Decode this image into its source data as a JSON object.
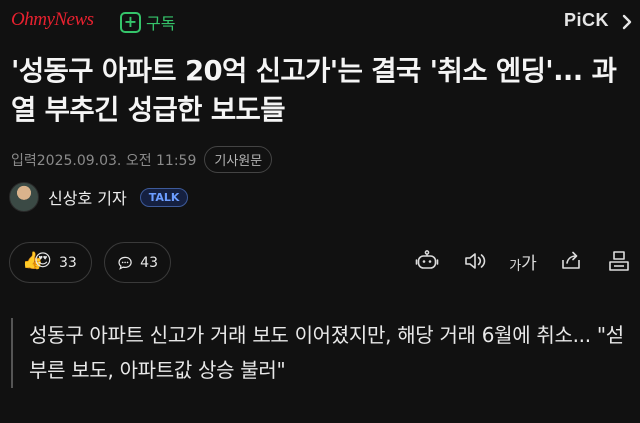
{
  "header": {
    "logo_text": "OhmyNews",
    "subscribe_label": "구독",
    "subscribe_icon": "plus-icon",
    "pick_label": "PiCK",
    "pick_chevron_icon": "chevron-right-icon",
    "colors": {
      "logo": "#e8212f",
      "subscribe": "#35c46a"
    }
  },
  "article": {
    "headline": "'성동구 아파트 20억 신고가'는 결국 '취소 엔딩'... 과열 부추긴 성급한 보도들",
    "date": "입력2025.09.03. 오전 11:59",
    "original_button": "기사원문",
    "author": "신상호 기자",
    "talk_badge": "TALK"
  },
  "reactions": {
    "like_emoji": [
      "👍",
      "😍"
    ],
    "like_count": "33",
    "comment_icon": "comment-bubble-icon",
    "comment_count": "43"
  },
  "tools": {
    "summary_icon": "robot-summary-icon",
    "audio_icon": "speaker-icon",
    "font_small": "가",
    "font_large": "가",
    "share_icon": "share-icon",
    "print_icon": "print-icon"
  },
  "summary": {
    "text": "성동구 아파트 신고가 거래 보도 이어졌지만, 해당 거래 6월에 취소... \"섣부른 보도, 아파트값 상승 불러\""
  }
}
